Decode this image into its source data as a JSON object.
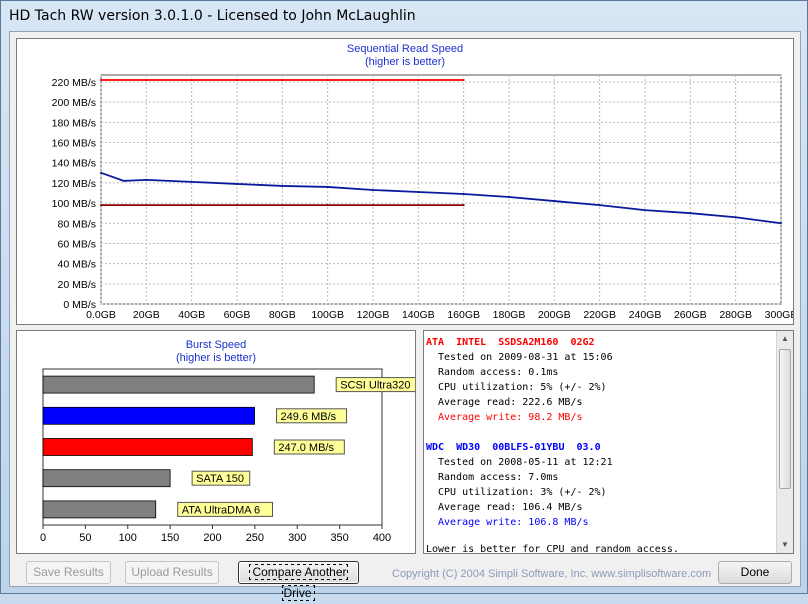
{
  "window": {
    "title": "HD Tach RW version 3.0.1.0 - Licensed to John McLaughlin"
  },
  "sequential": {
    "title": "Sequential Read Speed",
    "subtitle": "(higher is better)"
  },
  "burst": {
    "title": "Burst Speed",
    "subtitle": "(higher is better)"
  },
  "chart_data": [
    {
      "type": "line",
      "title": "Sequential Read Speed",
      "subtitle": "(higher is better)",
      "ylim": [
        0,
        220
      ],
      "xlim": [
        0,
        300
      ],
      "y_ticks": [
        "0 MB/s",
        "20 MB/s",
        "40 MB/s",
        "60 MB/s",
        "80 MB/s",
        "100 MB/s",
        "120 MB/s",
        "140 MB/s",
        "160 MB/s",
        "180 MB/s",
        "200 MB/s",
        "220 MB/s"
      ],
      "x_ticks": [
        "0.0GB",
        "20GB",
        "40GB",
        "60GB",
        "80GB",
        "100GB",
        "120GB",
        "140GB",
        "160GB",
        "180GB",
        "200GB",
        "220GB",
        "240GB",
        "260GB",
        "280GB",
        "300GB"
      ],
      "grid": true,
      "series": [
        {
          "color": "#ff0000",
          "x": [
            0,
            20,
            40,
            60,
            80,
            100,
            120,
            140,
            160
          ],
          "y": [
            222,
            222,
            222,
            222,
            222,
            222,
            222,
            222,
            222
          ]
        },
        {
          "color": "#8b0000",
          "x": [
            0,
            10,
            20,
            40,
            60,
            80,
            100,
            120,
            140,
            160
          ],
          "y": [
            98,
            98,
            98,
            98,
            98,
            98,
            98,
            98,
            98,
            98
          ]
        },
        {
          "color": "#0a1a9c",
          "x": [
            0,
            10,
            20,
            40,
            60,
            80,
            100,
            120,
            140,
            160,
            180,
            200,
            220,
            240,
            260,
            280,
            300
          ],
          "y": [
            130,
            122,
            123,
            121,
            119,
            117,
            116,
            113,
            111,
            109,
            106,
            102,
            98,
            93,
            90,
            86,
            80
          ]
        }
      ]
    },
    {
      "type": "bar",
      "title": "Burst Speed",
      "subtitle": "(higher is better)",
      "xlim": [
        0,
        400
      ],
      "x_ticks": [
        "0",
        "50",
        "100",
        "150",
        "200",
        "250",
        "300",
        "350",
        "400"
      ],
      "categories": [
        "SCSI Ultra320",
        "249.6 MB/s",
        "247.0 MB/s",
        "SATA 150",
        "ATA UltraDMA 6"
      ],
      "values": [
        320,
        249.6,
        247.0,
        150,
        133
      ],
      "colors": [
        "#808080",
        "#0000ff",
        "#ff0000",
        "#808080",
        "#808080"
      ]
    }
  ],
  "info": {
    "drive1": {
      "name": "ATA  INTEL  SSDSA2M160  02G2",
      "color": "#ff0000",
      "tested": "Tested on 2009-08-31 at 15:06",
      "random": "Random access: 0.1ms",
      "cpu": "CPU utilization: 5% (+/- 2%)",
      "read": "Average read: 222.6 MB/s",
      "write": "Average write: 98.2 MB/s"
    },
    "drive2": {
      "name": "WDC  WD30  00BLFS-01YBU  03.0",
      "color": "#0000ff",
      "tested": "Tested on 2008-05-11 at 12:21",
      "random": "Random access: 7.0ms",
      "cpu": "CPU utilization: 3% (+/- 2%)",
      "read": "Average read: 106.4 MB/s",
      "write": "Average write: 106.8 MB/s"
    },
    "footer": "Lower is better for CPU and random access."
  },
  "buttons": {
    "save": "Save Results",
    "upload": "Upload Results",
    "compare": "Compare Another Drive",
    "done": "Done"
  },
  "copyright": "Copyright (C) 2004 Simpli Software, Inc. www.simplisoftware.com"
}
